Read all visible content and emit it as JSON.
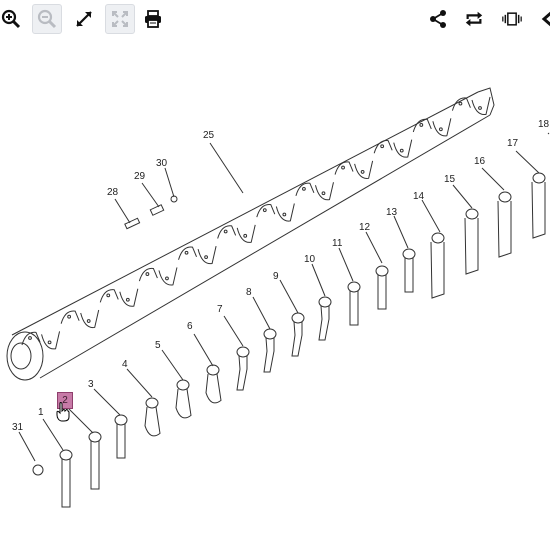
{
  "toolbar": {
    "zoom_in_icon": "zoom-in-icon",
    "zoom_out_icon": "zoom-out-icon",
    "expand_icon": "expand-icon",
    "fit_icon": "fit-screen-icon",
    "print_icon": "print-icon",
    "share_icon": "share-icon",
    "rotate_icon": "rotate-icon",
    "carousel_icon": "carousel-icon",
    "prev_icon": "chevron-left-icon"
  },
  "callouts": [
    {
      "id": "1",
      "label": "1"
    },
    {
      "id": "2",
      "label": "2",
      "active": true
    },
    {
      "id": "3",
      "label": "3"
    },
    {
      "id": "4",
      "label": "4"
    },
    {
      "id": "5",
      "label": "5"
    },
    {
      "id": "6",
      "label": "6"
    },
    {
      "id": "7",
      "label": "7"
    },
    {
      "id": "8",
      "label": "8"
    },
    {
      "id": "9",
      "label": "9"
    },
    {
      "id": "10",
      "label": "10"
    },
    {
      "id": "11",
      "label": "11"
    },
    {
      "id": "12",
      "label": "12"
    },
    {
      "id": "13",
      "label": "13"
    },
    {
      "id": "14",
      "label": "14"
    },
    {
      "id": "15",
      "label": "15"
    },
    {
      "id": "16",
      "label": "16"
    },
    {
      "id": "17",
      "label": "17"
    },
    {
      "id": "18",
      "label": "18"
    },
    {
      "id": "25",
      "label": "25"
    },
    {
      "id": "28",
      "label": "28"
    },
    {
      "id": "29",
      "label": "29"
    },
    {
      "id": "30",
      "label": "30"
    },
    {
      "id": "31",
      "label": "31"
    }
  ],
  "colors": {
    "highlight": "#c77aa7",
    "line": "#333333"
  }
}
